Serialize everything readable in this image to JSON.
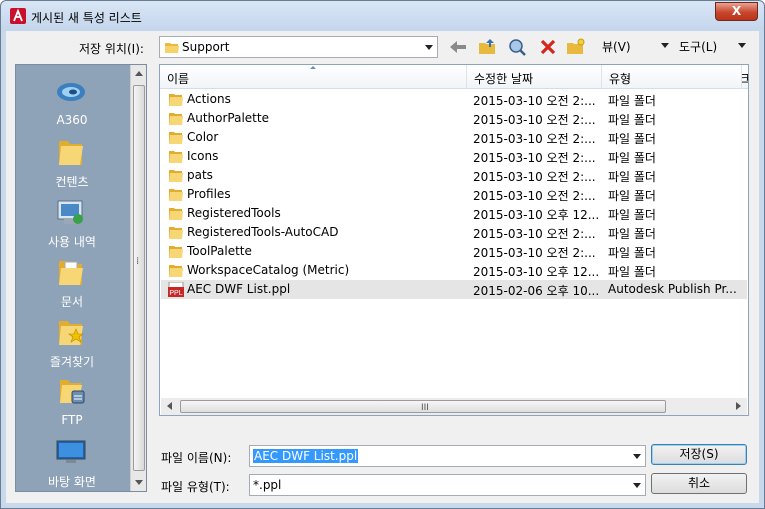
{
  "window": {
    "title": "게시된 새 특성 리스트",
    "close_label": "X"
  },
  "toolbar": {
    "save_in_label": "저장 위치(I):",
    "save_in_value": "Support",
    "views_label": "뷰(V)",
    "tools_label": "도구(L)"
  },
  "places": [
    {
      "label": "A360",
      "icon": "a360-icon"
    },
    {
      "label": "컨텐츠",
      "icon": "folder-icon"
    },
    {
      "label": "사용 내역",
      "icon": "history-icon"
    },
    {
      "label": "문서",
      "icon": "documents-icon"
    },
    {
      "label": "즐겨찾기",
      "icon": "favorites-icon"
    },
    {
      "label": "FTP",
      "icon": "ftp-icon"
    },
    {
      "label": "바탕 화면",
      "icon": "desktop-icon"
    }
  ],
  "columns": {
    "name": "이름",
    "modified": "수정한 날짜",
    "type": "유형",
    "more": "크"
  },
  "files": [
    {
      "name": "Actions",
      "modified": "2015-03-10 오전 2:...",
      "type": "파일 폴더",
      "icon": "folder-icon"
    },
    {
      "name": "AuthorPalette",
      "modified": "2015-03-10 오전 2:...",
      "type": "파일 폴더",
      "icon": "folder-icon"
    },
    {
      "name": "Color",
      "modified": "2015-03-10 오전 2:...",
      "type": "파일 폴더",
      "icon": "folder-icon"
    },
    {
      "name": "Icons",
      "modified": "2015-03-10 오전 2:...",
      "type": "파일 폴더",
      "icon": "folder-icon"
    },
    {
      "name": "pats",
      "modified": "2015-03-10 오전 2:...",
      "type": "파일 폴더",
      "icon": "folder-icon"
    },
    {
      "name": "Profiles",
      "modified": "2015-03-10 오전 2:...",
      "type": "파일 폴더",
      "icon": "folder-icon"
    },
    {
      "name": "RegisteredTools",
      "modified": "2015-03-10 오후 12...",
      "type": "파일 폴더",
      "icon": "folder-icon"
    },
    {
      "name": "RegisteredTools-AutoCAD",
      "modified": "2015-03-10 오전 2:...",
      "type": "파일 폴더",
      "icon": "folder-icon"
    },
    {
      "name": "ToolPalette",
      "modified": "2015-03-10 오전 2:...",
      "type": "파일 폴더",
      "icon": "folder-icon"
    },
    {
      "name": "WorkspaceCatalog (Metric)",
      "modified": "2015-03-10 오후 12...",
      "type": "파일 폴더",
      "icon": "folder-icon"
    },
    {
      "name": "AEC DWF List.ppl",
      "modified": "2015-02-06 오후 10...",
      "type": "Autodesk Publish Pr...",
      "icon": "ppl-file-icon",
      "icon_text": "PPL"
    }
  ],
  "footer": {
    "filename_label": "파일 이름(N):",
    "filename_value": "AEC DWF List.ppl",
    "filetype_label": "파일 유형(T):",
    "filetype_value": "*.ppl",
    "save_button": "저장(S)",
    "cancel_button": "취소"
  },
  "scroll_grip": "⁞"
}
